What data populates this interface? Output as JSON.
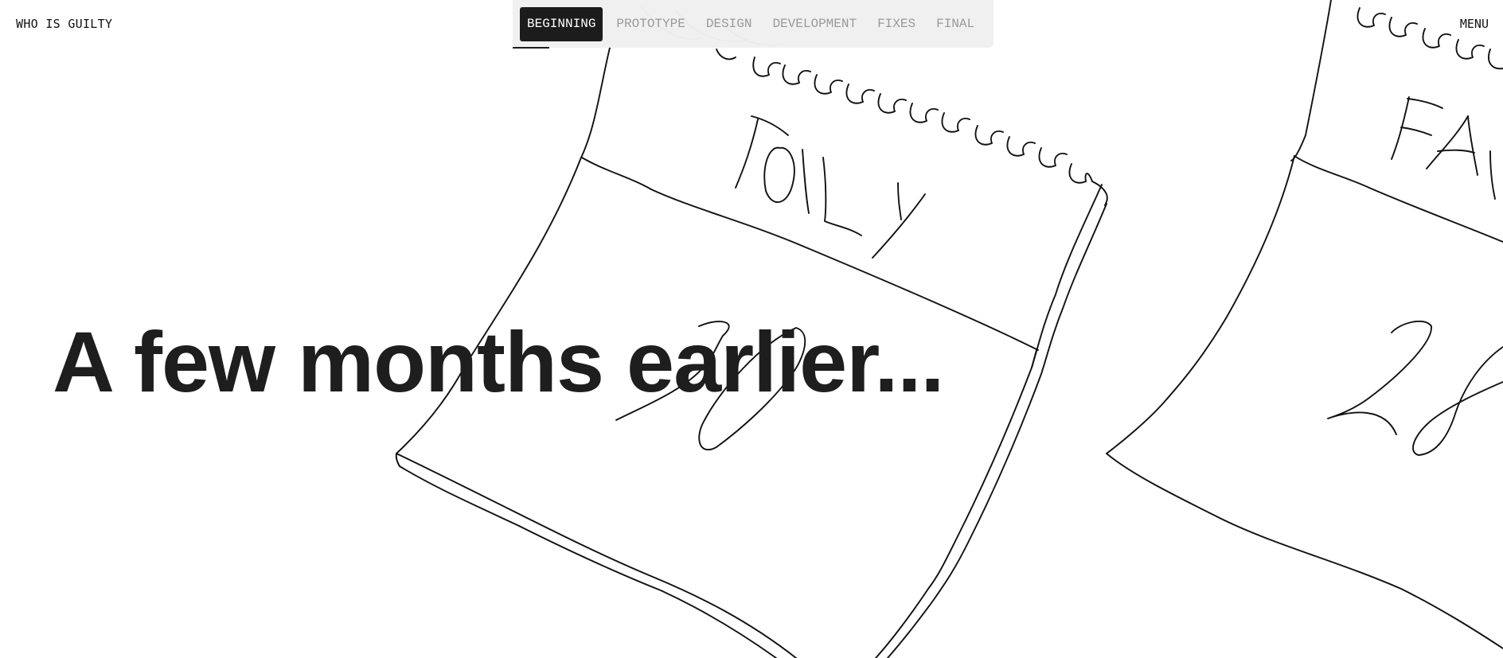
{
  "header": {
    "logo_text": "WHO IS GUILTY",
    "menu_label": "MENU"
  },
  "chapter_nav": {
    "tabs": [
      {
        "label": "BEGINNING",
        "active": true
      },
      {
        "label": "PROTOTYPE",
        "active": false
      },
      {
        "label": "DESIGN",
        "active": false
      },
      {
        "label": "DEVELOPMENT",
        "active": false
      },
      {
        "label": "FIXES",
        "active": false
      },
      {
        "label": "FINAL",
        "active": false
      }
    ]
  },
  "hero": {
    "headline": "A few months earlier..."
  },
  "illustration": {
    "calendar_left_label": "TOILY",
    "calendar_right_label": "FAI..."
  },
  "colors": {
    "text": "#1e1e1e",
    "active_tab_bg": "#1c1c1c",
    "active_tab_text": "#ffffff",
    "inactive_tab_text": "#9a9a9a",
    "nav_bg": "#eeeeee",
    "background": "#ffffff",
    "sketch_stroke": "#111111"
  }
}
